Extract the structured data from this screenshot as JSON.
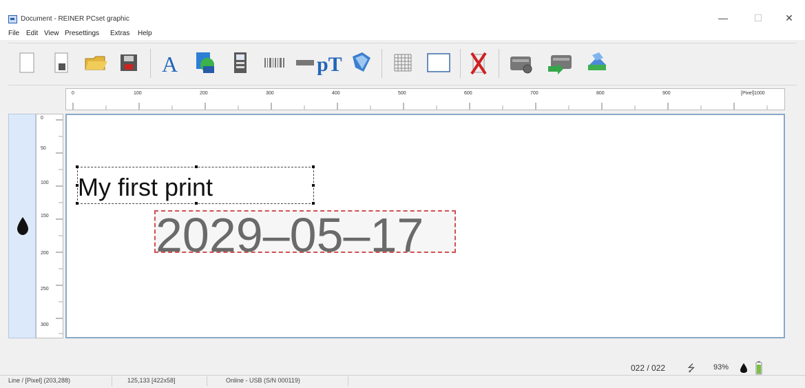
{
  "window": {
    "title": "Document - REINER PCset graphic",
    "minimize": "—",
    "maximize": "☐",
    "close": "✕"
  },
  "menu": [
    "File",
    "Edit",
    "View",
    "Presettings",
    "Extras",
    "Help"
  ],
  "ruler": {
    "horizontal_ticks": [
      "0",
      "100",
      "200",
      "300",
      "400",
      "500",
      "600",
      "700",
      "800",
      "900",
      "[Pixel]1000"
    ],
    "vertical_ticks": [
      "0",
      "50",
      "100",
      "150",
      "200",
      "250",
      "300"
    ]
  },
  "canvas": {
    "text_item": "My first print",
    "date_item": "2029–05–17"
  },
  "indicators": {
    "print_counter": "022 / 022",
    "ink_level": "93%"
  },
  "status": {
    "tool_info": "Line / [Pixel] (203,288)",
    "position_size": "125,133 [422x58]",
    "connection": "Online - USB (S/N 000119)"
  },
  "colors": {
    "canvas_border": "#8aa8c8",
    "selection_dash": "#d05050",
    "left_strip": "#dce9fb"
  }
}
